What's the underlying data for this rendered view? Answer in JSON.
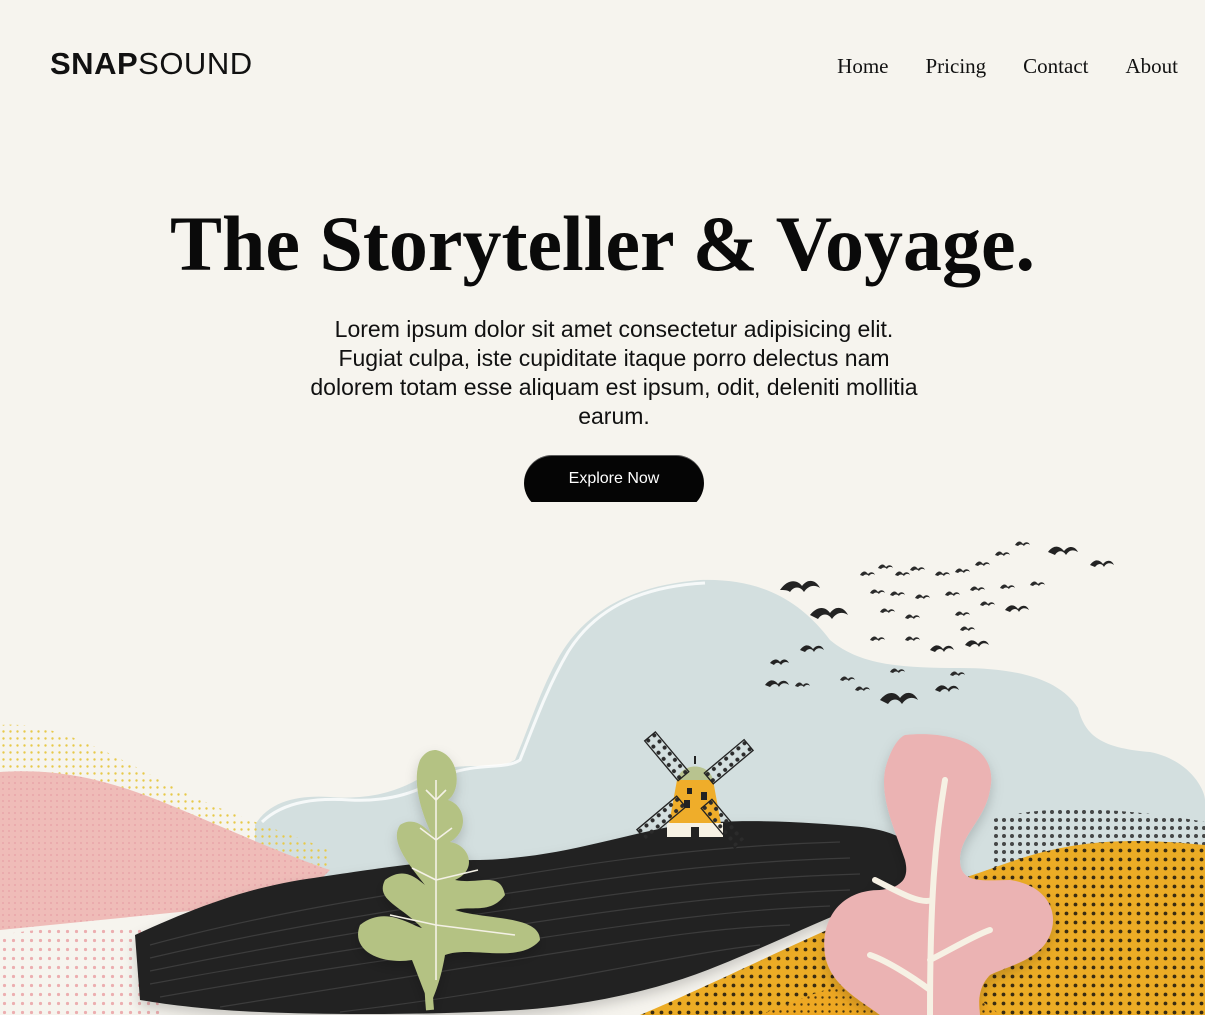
{
  "brand": {
    "bold": "SNAP",
    "light": "SOUND"
  },
  "nav": [
    {
      "label": "Home"
    },
    {
      "label": "Pricing"
    },
    {
      "label": "Contact"
    },
    {
      "label": "About"
    }
  ],
  "hero": {
    "title": "The Storyteller & Voyage.",
    "text": "Lorem ipsum dolor sit amet consectetur adipisicing elit. Fugiat culpa, iste cupiditate itaque porro delectus nam dolorem totam esse aliquam est ipsum, odit, deleniti mollitia earum.",
    "cta_label": "Explore Now"
  },
  "colors": {
    "background": "#f6f4ee",
    "text": "#111111",
    "button": "#050505",
    "cloud": "#d3dfdf",
    "hill_black": "#222222",
    "pink": "#ebb3b3",
    "mustard": "#ecac25",
    "leaf_green": "#b4c283"
  }
}
